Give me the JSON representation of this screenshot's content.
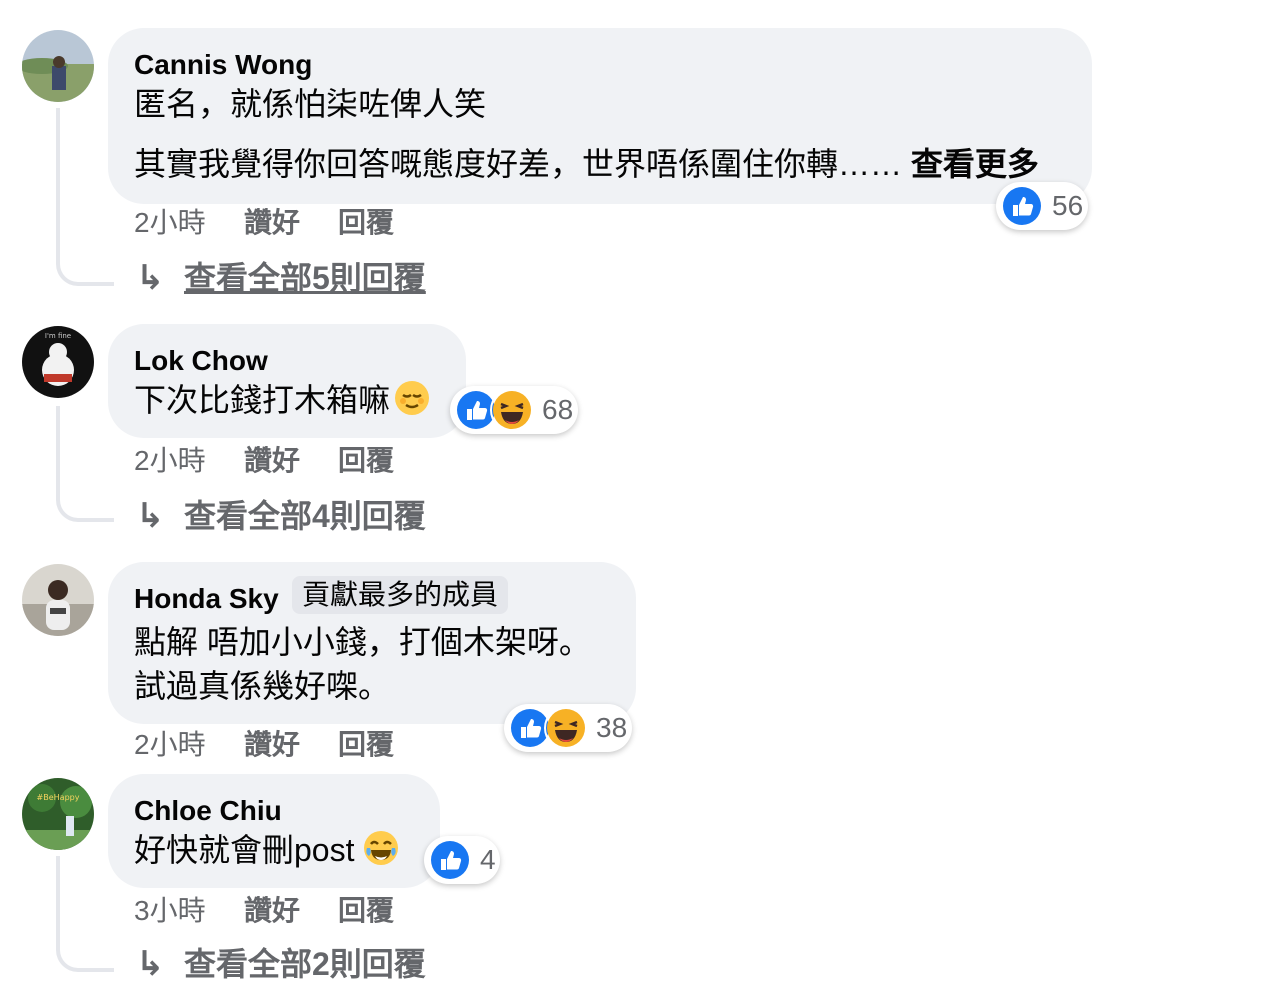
{
  "comments": [
    {
      "author": "Cannis Wong",
      "text_lines": [
        "匿名，就係怕柒咗俾人笑",
        "其實我覺得你回答嘅態度好差，世界唔係圍住你轉……"
      ],
      "see_more": "查看更多",
      "time": "2小時",
      "like_label": "讚好",
      "reply_label": "回覆",
      "reaction_count": "56",
      "reactions": [
        "like-icon"
      ],
      "view_replies": "查看全部5則回覆"
    },
    {
      "author": "Lok Chow",
      "text_lines": [
        "下次比錢打木箱嘛"
      ],
      "inline_emoji": "relieved-face-emoji",
      "time": "2小時",
      "like_label": "讚好",
      "reply_label": "回覆",
      "reaction_count": "68",
      "reactions": [
        "like-icon",
        "haha-icon"
      ],
      "view_replies": "查看全部4則回覆"
    },
    {
      "author": "Honda Sky",
      "badge": "貢獻最多的成員",
      "text_lines": [
        "點解 唔加小小錢，打個木架呀。",
        "試過真係幾好㗎。"
      ],
      "time": "2小時",
      "like_label": "讚好",
      "reply_label": "回覆",
      "reaction_count": "38",
      "reactions": [
        "like-icon",
        "haha-icon"
      ]
    },
    {
      "author": "Chloe Chiu",
      "text_lines": [
        "好快就會刪post"
      ],
      "inline_emoji": "tears-of-joy-emoji",
      "time": "3小時",
      "like_label": "讚好",
      "reply_label": "回覆",
      "reaction_count": "4",
      "reactions": [
        "like-icon"
      ],
      "view_replies": "查看全部2則回覆"
    }
  ],
  "colors": {
    "bubble": "#f0f2f5",
    "secondary_text": "#65676b",
    "like_blue": "#1877f2",
    "haha_yellow": "#f7b125"
  }
}
